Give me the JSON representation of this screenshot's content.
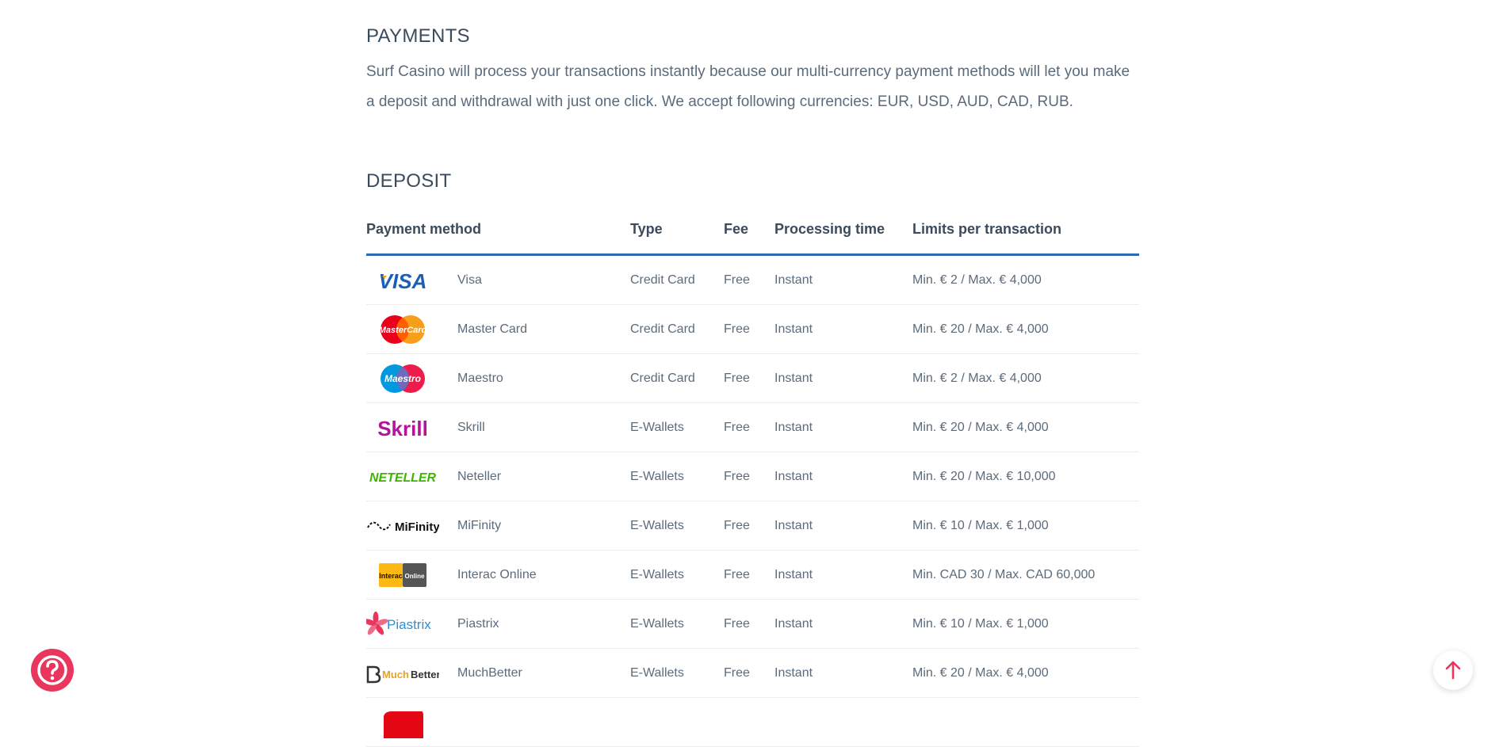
{
  "payments": {
    "title": "PAYMENTS",
    "text": "Surf Casino will process your transactions instantly because our multi-currency payment methods will let you make a deposit and withdrawal with just one click. We accept following currencies: EUR, USD, AUD, CAD, RUB."
  },
  "deposit": {
    "title": "DEPOSIT",
    "headers": {
      "method": "Payment method",
      "type": "Type",
      "fee": "Fee",
      "processing": "Processing time",
      "limits": "Limits per transaction"
    },
    "rows": [
      {
        "logo": "visa-logo",
        "name": "Visa",
        "type": "Credit Card",
        "fee": "Free",
        "processing": "Instant",
        "limits": "Min. € 2 / Max. € 4,000"
      },
      {
        "logo": "mastercard-logo",
        "name": "Master Card",
        "type": "Credit Card",
        "fee": "Free",
        "processing": "Instant",
        "limits": "Min. € 20 / Max. € 4,000"
      },
      {
        "logo": "maestro-logo",
        "name": "Maestro",
        "type": "Credit Card",
        "fee": "Free",
        "processing": "Instant",
        "limits": "Min. € 2 / Max. € 4,000"
      },
      {
        "logo": "skrill-logo",
        "name": "Skrill",
        "type": "E-Wallets",
        "fee": "Free",
        "processing": "Instant",
        "limits": "Min. € 20 / Max. € 4,000"
      },
      {
        "logo": "neteller-logo",
        "name": "Neteller",
        "type": "E-Wallets",
        "fee": "Free",
        "processing": "Instant",
        "limits": "Min. € 20 / Max. € 10,000"
      },
      {
        "logo": "mifinity-logo",
        "name": "MiFinity",
        "type": "E-Wallets",
        "fee": "Free",
        "processing": "Instant",
        "limits": "Min. € 10 / Max. € 1,000"
      },
      {
        "logo": "interac-logo",
        "name": "Interac Online",
        "type": "E-Wallets",
        "fee": "Free",
        "processing": "Instant",
        "limits": "Min. CAD 30 / Max. CAD 60,000"
      },
      {
        "logo": "piastrix-logo",
        "name": "Piastrix",
        "type": "E-Wallets",
        "fee": "Free",
        "processing": "Instant",
        "limits": "Min. € 10 / Max. € 1,000"
      },
      {
        "logo": "muchbetter-logo",
        "name": "MuchBetter",
        "type": "E-Wallets",
        "fee": "Free",
        "processing": "Instant",
        "limits": "Min. € 20 / Max. € 4,000"
      }
    ]
  },
  "logo_text": {
    "visa": "VISA",
    "mastercard": "MasterCard",
    "maestro": "Maestro",
    "skrill": "Skrill",
    "neteller": "NETELLER",
    "mifinity": "MiFinity",
    "interac_a": "Interac",
    "interac_b": "Online",
    "piastrix": "Piastrix",
    "muchbetter_a": "Much",
    "muchbetter_b": "Better"
  },
  "colors": {
    "accent_blue": "#2c6ab5",
    "help_button": "#e8365d",
    "scroll_top_arrow": "#e8365d"
  },
  "icons": {
    "help": "question-icon",
    "scroll_top": "arrow-up-icon"
  }
}
